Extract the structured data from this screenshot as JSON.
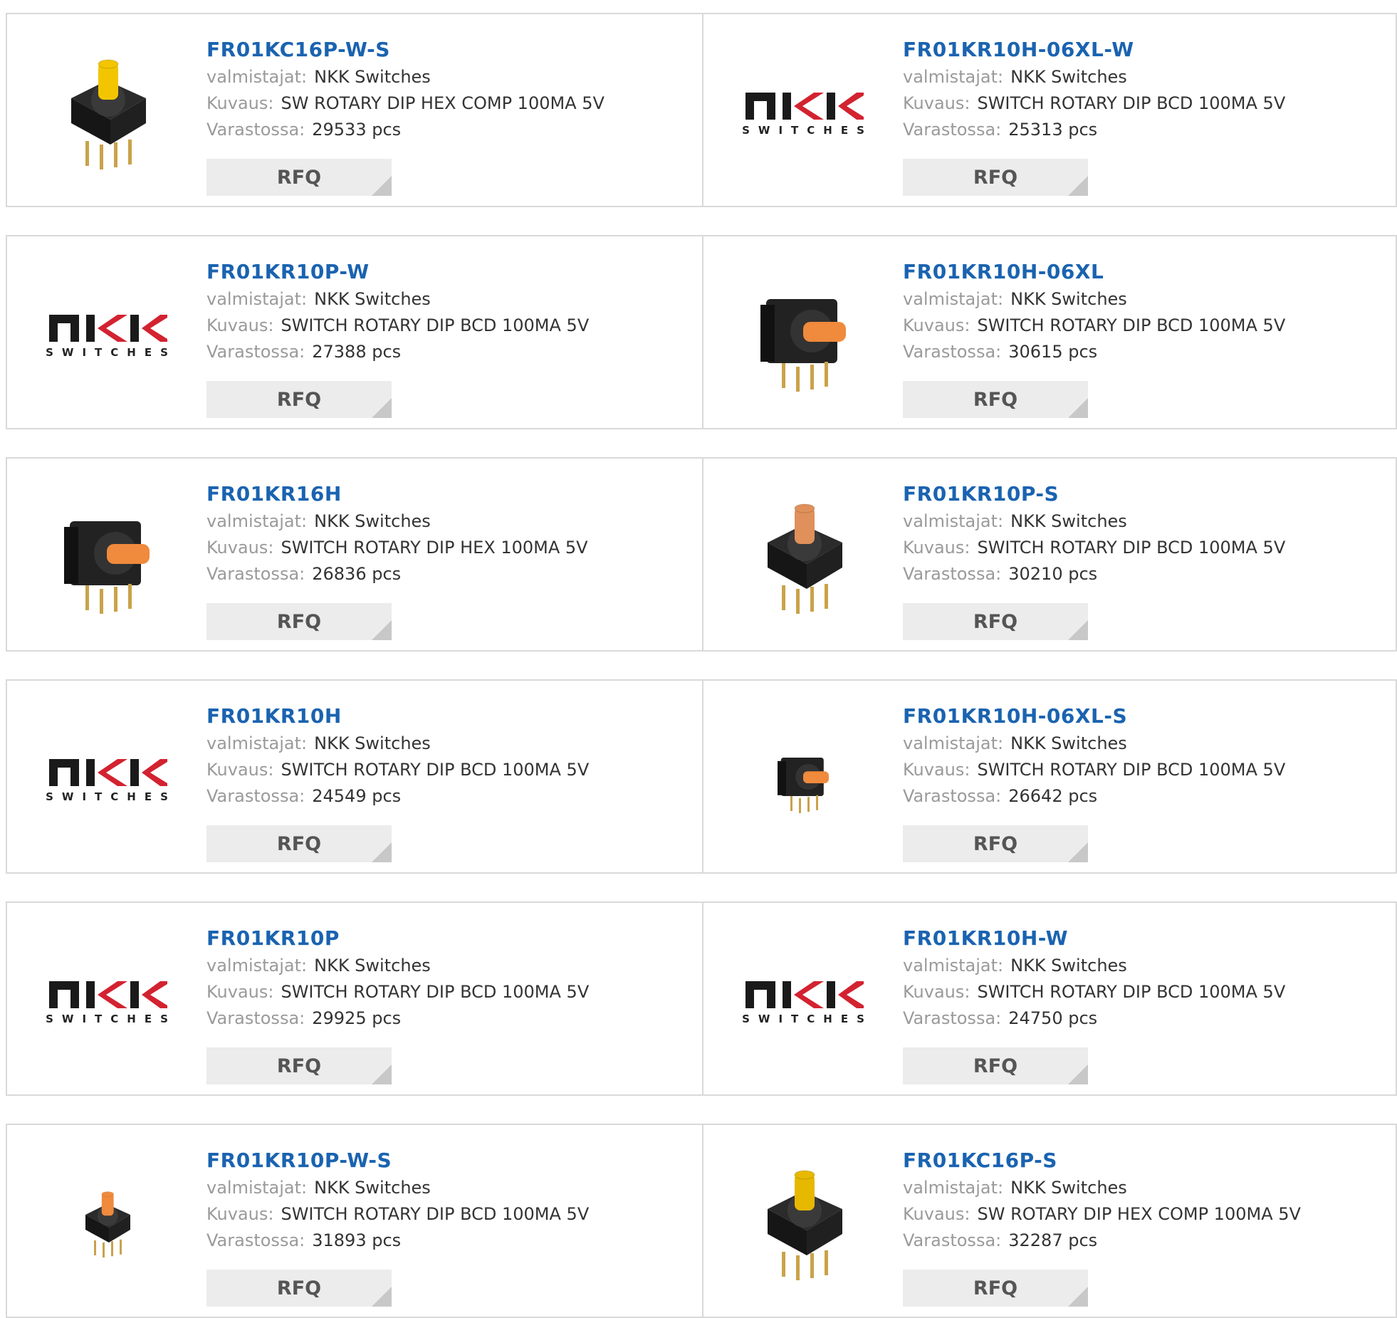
{
  "labels": {
    "manufacturer": "valmistajat:",
    "description": "Kuvaus:",
    "stock": "Varastossa:",
    "rfq": "RFQ"
  },
  "logo": {
    "brand_lower": "SWITCHES",
    "accent_color": "#d32230"
  },
  "colors": {
    "title": "#1a63b0",
    "border": "#d9d9d9",
    "rfq_bg": "#ececec"
  },
  "rows": [
    {
      "left": {
        "part": "FR01KC16P-W-S",
        "manufacturer": "NKK Switches",
        "description": "SW ROTARY DIP HEX COMP 100MA 5V",
        "stock": "29533 pcs",
        "image": "yellow-knob-switch"
      },
      "right": {
        "part": "FR01KR10H-06XL-W",
        "manufacturer": "NKK Switches",
        "description": "SWITCH ROTARY DIP BCD 100MA 5V",
        "stock": "25313 pcs",
        "image": "nkk-logo"
      }
    },
    {
      "left": {
        "part": "FR01KR10P-W",
        "manufacturer": "NKK Switches",
        "description": "SWITCH ROTARY DIP BCD 100MA 5V",
        "stock": "27388 pcs",
        "image": "nkk-logo"
      },
      "right": {
        "part": "FR01KR10H-06XL",
        "manufacturer": "NKK Switches",
        "description": "SWITCH ROTARY DIP BCD 100MA 5V",
        "stock": "30615 pcs",
        "image": "side-orange-switch"
      }
    },
    {
      "left": {
        "part": "FR01KR16H",
        "manufacturer": "NKK Switches",
        "description": "SWITCH ROTARY DIP HEX 100MA 5V",
        "stock": "26836 pcs",
        "image": "side-orange-switch"
      },
      "right": {
        "part": "FR01KR10P-S",
        "manufacturer": "NKK Switches",
        "description": "SWITCH ROTARY DIP BCD 100MA 5V",
        "stock": "30210 pcs",
        "image": "top-orange-switch"
      }
    },
    {
      "left": {
        "part": "FR01KR10H",
        "manufacturer": "NKK Switches",
        "description": "SWITCH ROTARY DIP BCD 100MA 5V",
        "stock": "24549 pcs",
        "image": "nkk-logo"
      },
      "right": {
        "part": "FR01KR10H-06XL-S",
        "manufacturer": "NKK Switches",
        "description": "SWITCH ROTARY DIP BCD 100MA 5V",
        "stock": "26642 pcs",
        "image": "small-side-orange-switch"
      }
    },
    {
      "left": {
        "part": "FR01KR10P",
        "manufacturer": "NKK Switches",
        "description": "SWITCH ROTARY DIP BCD 100MA 5V",
        "stock": "29925 pcs",
        "image": "nkk-logo"
      },
      "right": {
        "part": "FR01KR10H-W",
        "manufacturer": "NKK Switches",
        "description": "SWITCH ROTARY DIP BCD 100MA 5V",
        "stock": "24750 pcs",
        "image": "nkk-logo"
      }
    },
    {
      "left": {
        "part": "FR01KR10P-W-S",
        "manufacturer": "NKK Switches",
        "description": "SWITCH ROTARY DIP BCD 100MA 5V",
        "stock": "31893 pcs",
        "image": "small-orange-switch"
      },
      "right": {
        "part": "FR01KC16P-S",
        "manufacturer": "NKK Switches",
        "description": "SW ROTARY DIP HEX COMP 100MA 5V",
        "stock": "32287 pcs",
        "image": "top-yellow-switch"
      }
    }
  ]
}
